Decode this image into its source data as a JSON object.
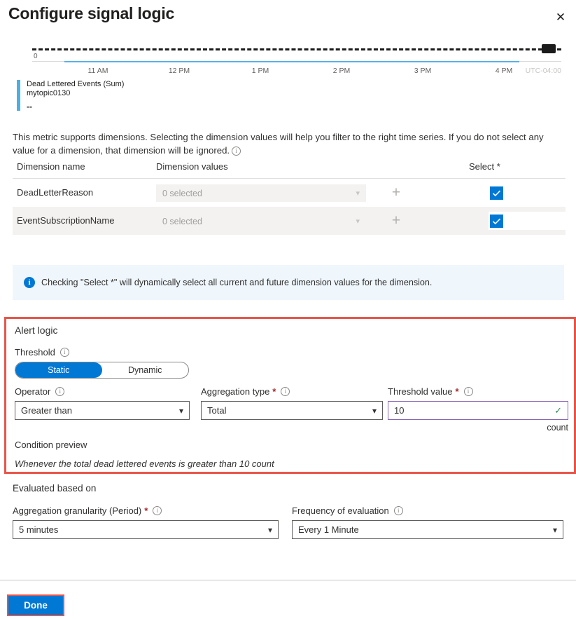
{
  "header": {
    "title": "Configure signal logic",
    "close_label": "✕"
  },
  "chart": {
    "legend": {
      "metric": "Dead Lettered Events (Sum)",
      "resource": "mytopic0130",
      "value": "--"
    },
    "timezone": "UTC-04:00",
    "y_zero_label": "0"
  },
  "chart_data": {
    "type": "line",
    "title": "Dead Lettered Events (Sum)",
    "subtitle": "mytopic0130",
    "xlabel": "",
    "ylabel": "",
    "x_tick_labels": [
      "11 AM",
      "12 PM",
      "1 PM",
      "2 PM",
      "3 PM",
      "4 PM"
    ],
    "y_tick_labels": [
      "0"
    ],
    "ylim": [
      0,
      12
    ],
    "grid": false,
    "legend_position": "below",
    "timezone": "UTC-04:00",
    "series": [
      {
        "name": "Dead Lettered Events (Sum) mytopic0130",
        "color": "#4ab0e4",
        "current_value": "--",
        "x": [
          "11 AM",
          "12 PM",
          "1 PM",
          "2 PM",
          "3 PM",
          "4 PM"
        ],
        "values": [
          0,
          0,
          0,
          0,
          0,
          0
        ]
      },
      {
        "name": "Threshold",
        "color": "#1b1b1b",
        "style": "dashed",
        "values": [
          10,
          10,
          10,
          10,
          10,
          10
        ]
      }
    ]
  },
  "description": {
    "text": "This metric supports dimensions. Selecting the dimension values will help you filter to the right time series. If you do not select any value for a dimension, that dimension will be ignored.",
    "info_icon": "ⓘ"
  },
  "dimensions_table": {
    "columns": [
      "Dimension name",
      "Dimension values",
      "Select *"
    ],
    "rows": [
      {
        "name": "DeadLetterReason",
        "values_text": "0 selected",
        "add_label": "+",
        "selected": true
      },
      {
        "name": "EventSubscriptionName",
        "values_text": "0 selected",
        "add_label": "+",
        "selected": true
      }
    ]
  },
  "banner": {
    "icon": "i",
    "text": "Checking \"Select *\" will dynamically select all current and future dimension values for the dimension."
  },
  "alert_logic": {
    "section_title": "Alert logic",
    "threshold_label": "Threshold",
    "toggle": {
      "static": "Static",
      "dynamic": "Dynamic",
      "selected": "Static"
    },
    "operator": {
      "label": "Operator",
      "value": "Greater than"
    },
    "aggregation_type": {
      "label": "Aggregation type",
      "required": "*",
      "value": "Total"
    },
    "threshold_value": {
      "label": "Threshold value",
      "required": "*",
      "value": "10",
      "unit": "count"
    },
    "condition_preview": {
      "label": "Condition preview",
      "text": "Whenever the total dead lettered events is greater than 10 count"
    },
    "highlight_color": "#e8564a"
  },
  "evaluated_based_on": {
    "section_title": "Evaluated based on",
    "aggregation_granularity": {
      "label": "Aggregation granularity (Period)",
      "required": "*",
      "value": "5 minutes"
    },
    "frequency_of_evaluation": {
      "label": "Frequency of evaluation",
      "value": "Every 1 Minute"
    }
  },
  "footer": {
    "done_label": "Done",
    "highlight_color": "#e8564a"
  }
}
